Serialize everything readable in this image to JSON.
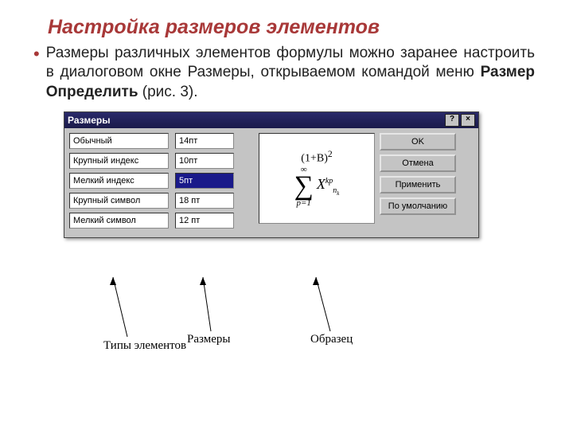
{
  "title": "Настройка размеров элементов",
  "body": {
    "pre": "Размеры различных элементов формулы можно заранее настроить в диалоговом окне Размеры, открываемом командой меню ",
    "bold1": "Размер",
    "arrow": " ",
    "bold2": "Определить",
    "post": " (рис. 3)."
  },
  "dialog": {
    "title": "Размеры",
    "help": "?",
    "close": "×",
    "fields": [
      {
        "label": "Обычный",
        "value": "14пт"
      },
      {
        "label": "Крупный индекс",
        "value": "10пт"
      },
      {
        "label": "Мелкий индекс",
        "value": "5пт",
        "selected": true
      },
      {
        "label": "Крупный символ",
        "value": "18 пт"
      },
      {
        "label": "Мелкий символ",
        "value": "12 пт"
      }
    ],
    "preview": {
      "top": "(1+B)",
      "top_sup": "2",
      "sigma_top": "∞",
      "sigma_bot": "p=1",
      "rhs": "X",
      "sup": "kp",
      "sub": "n",
      "subsub": "k"
    },
    "buttons": [
      "OK",
      "Отмена",
      "Применить",
      "По умолчанию"
    ]
  },
  "callouts": {
    "types": "Типы элементов",
    "sizes": "Размеры",
    "sample": "Образец"
  }
}
